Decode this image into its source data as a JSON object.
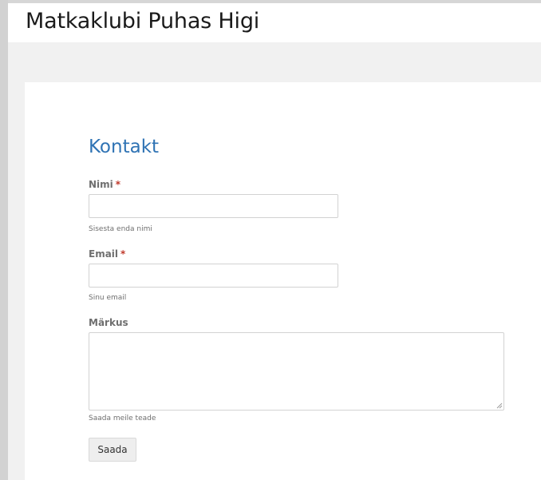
{
  "site": {
    "title": "Matkaklubi Puhas Higi"
  },
  "page": {
    "title": "Kontakt"
  },
  "form": {
    "required_marker": "*",
    "name": {
      "label": "Nimi",
      "value": "",
      "help": "Sisesta enda nimi"
    },
    "email": {
      "label": "Email",
      "value": "",
      "help": "Sinu email"
    },
    "message": {
      "label": "Märkus",
      "value": "",
      "help": "Saada meile teade"
    },
    "submit_label": "Saada"
  },
  "colors": {
    "title_blue": "#2f73b4",
    "required_red": "#c0392b",
    "label_gray": "#6f6f6f",
    "background_gray": "#f1f1f1"
  },
  "icons": {
    "textarea_resize": "resize-grip-icon"
  }
}
